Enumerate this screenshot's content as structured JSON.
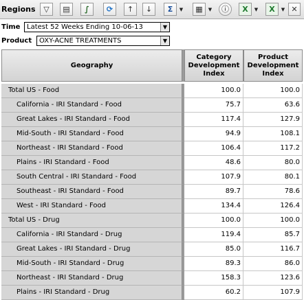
{
  "toolbar": {
    "title": "Regions",
    "icons": [
      {
        "name": "filter-icon",
        "glyph": "▽"
      },
      {
        "name": "table-view-icon",
        "glyph": "▤"
      },
      {
        "name": "chart-formula-icon",
        "glyph": "∫"
      },
      {
        "name": "refresh-icon",
        "glyph": "⟳"
      },
      {
        "name": "sort-ascending-icon",
        "glyph": "↑"
      },
      {
        "name": "sort-descending-icon",
        "glyph": "↓"
      },
      {
        "name": "sum-icon",
        "glyph": "Σ"
      },
      {
        "name": "layout-grid-icon",
        "glyph": "▦"
      },
      {
        "name": "info-icon",
        "glyph": "ⓘ"
      },
      {
        "name": "export-excel-icon",
        "glyph": "X"
      },
      {
        "name": "export-excel-options-icon",
        "glyph": "X"
      },
      {
        "name": "close-icon",
        "glyph": "✕"
      }
    ]
  },
  "filters": {
    "time_label": "Time",
    "time_value": "Latest 52 Weeks Ending 10-06-13",
    "product_label": "Product",
    "product_value": "OXY-ACNE TREATMENTS"
  },
  "table": {
    "columns": [
      "Geography",
      "Category Development Index",
      "Product Development Index"
    ],
    "rows": [
      {
        "geography": "Total US - Food",
        "level": 0,
        "cdi": "100.0",
        "pdi": "100.0"
      },
      {
        "geography": "California - IRI Standard - Food",
        "level": 1,
        "cdi": "75.7",
        "pdi": "63.6"
      },
      {
        "geography": "Great Lakes - IRI Standard - Food",
        "level": 1,
        "cdi": "117.4",
        "pdi": "127.9"
      },
      {
        "geography": "Mid-South - IRI Standard - Food",
        "level": 1,
        "cdi": "94.9",
        "pdi": "108.1"
      },
      {
        "geography": "Northeast - IRI Standard - Food",
        "level": 1,
        "cdi": "106.4",
        "pdi": "117.2"
      },
      {
        "geography": "Plains - IRI Standard - Food",
        "level": 1,
        "cdi": "48.6",
        "pdi": "80.0"
      },
      {
        "geography": "South Central - IRI Standard - Food",
        "level": 1,
        "cdi": "107.9",
        "pdi": "80.1"
      },
      {
        "geography": "Southeast - IRI Standard - Food",
        "level": 1,
        "cdi": "89.7",
        "pdi": "78.6"
      },
      {
        "geography": "West - IRI Standard - Food",
        "level": 1,
        "cdi": "134.4",
        "pdi": "126.4"
      },
      {
        "geography": "Total US - Drug",
        "level": 0,
        "cdi": "100.0",
        "pdi": "100.0"
      },
      {
        "geography": "California - IRI Standard - Drug",
        "level": 1,
        "cdi": "119.4",
        "pdi": "85.7"
      },
      {
        "geography": "Great Lakes - IRI Standard - Drug",
        "level": 1,
        "cdi": "85.0",
        "pdi": "116.7"
      },
      {
        "geography": "Mid-South - IRI Standard - Drug",
        "level": 1,
        "cdi": "89.3",
        "pdi": "86.0"
      },
      {
        "geography": "Northeast - IRI Standard - Drug",
        "level": 1,
        "cdi": "158.3",
        "pdi": "123.6"
      },
      {
        "geography": "Plains - IRI Standard - Drug",
        "level": 1,
        "cdi": "60.2",
        "pdi": "107.9"
      }
    ]
  },
  "colors": {
    "header_bg": "#d3d3d3",
    "row_header_bg": "#d6d6d6",
    "toolbar_bg": "#e6e6e6"
  }
}
